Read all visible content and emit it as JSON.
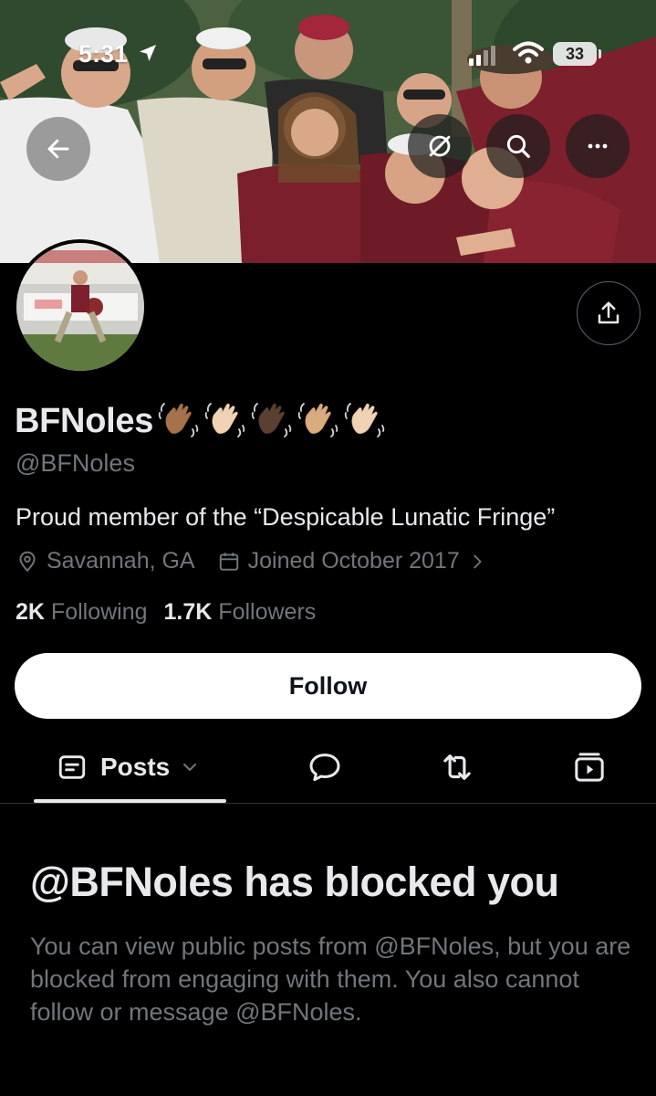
{
  "status_bar": {
    "time": "5:31",
    "battery": "33"
  },
  "header": {
    "back_icon": "arrow-left-icon",
    "translate_icon": "translate-slash-icon",
    "search_icon": "search-icon",
    "more_icon": "more-horizontal-icon"
  },
  "profile": {
    "display_name": "BFNoles",
    "name_emoji": [
      "waving-hand-medium-dark",
      "waving-hand-light",
      "waving-hand-dark",
      "waving-hand-medium-light",
      "waving-hand-light"
    ],
    "handle": "@BFNoles",
    "bio": "Proud member of the “Despicable Lunatic Fringe”",
    "location": "Savannah, GA",
    "joined": "Joined October 2017",
    "following_count": "2K",
    "following_label": "Following",
    "followers_count": "1.7K",
    "followers_label": "Followers",
    "follow_button": "Follow"
  },
  "tabs": [
    {
      "label": "Posts",
      "icon": "posts-icon",
      "active": true
    },
    {
      "label": "",
      "icon": "reply-icon",
      "active": false
    },
    {
      "label": "",
      "icon": "retweet-icon",
      "active": false
    },
    {
      "label": "",
      "icon": "media-icon",
      "active": false
    }
  ],
  "blocked": {
    "title": "@BFNoles has blocked you",
    "message": "You can view public posts from @BFNoles, but you are blocked from engaging with them. You also cannot follow or message @BFNoles."
  },
  "colors": {
    "background": "#000000",
    "text_primary": "#e7e9ea",
    "text_secondary": "#71767b",
    "follow_bg": "#ffffff"
  }
}
